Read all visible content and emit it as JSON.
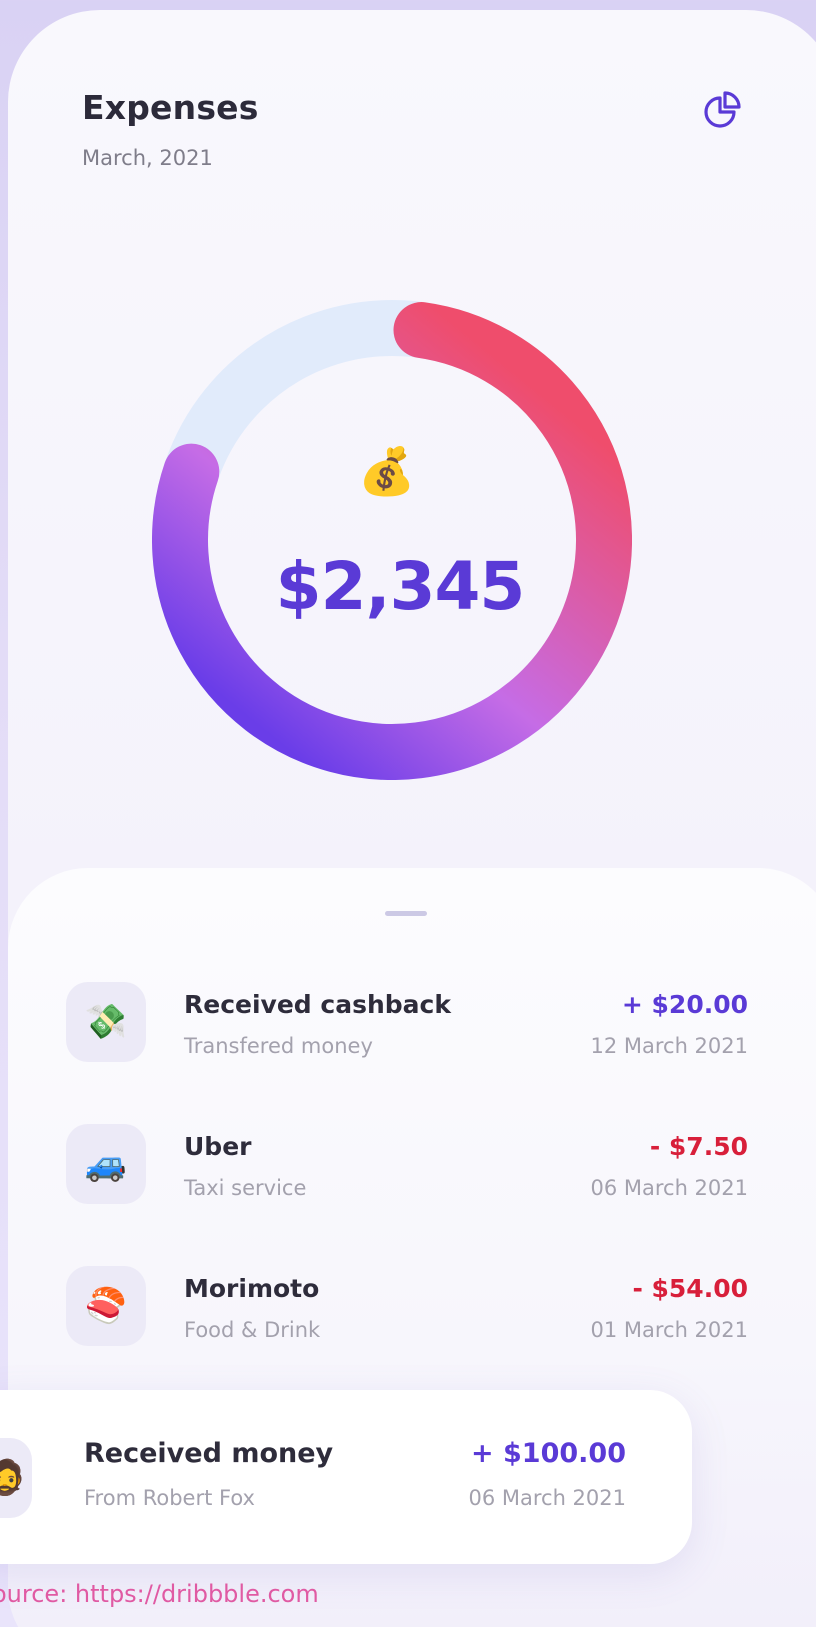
{
  "header": {
    "title": "Expenses",
    "subtitle": "March, 2021",
    "action_icon": "pie-chart-icon"
  },
  "summary": {
    "emoji": "💰",
    "total": "$2,345",
    "progress_fraction": 0.78,
    "colors": {
      "track": "#e1ebfb",
      "gradient_start": "#6a3de8",
      "gradient_mid": "#c56ce6",
      "gradient_end": "#ef4d6c",
      "accent": "#5a3ad6",
      "negative": "#d81f3a"
    }
  },
  "transactions": [
    {
      "emoji": "💸",
      "icon": "money-wings-icon",
      "title": "Received cashback",
      "subtitle": "Transfered money",
      "amount": "+ $20.00",
      "date": "12 March 2021",
      "type": "credit"
    },
    {
      "emoji": "🚙",
      "icon": "car-icon",
      "title": "Uber",
      "subtitle": "Taxi service",
      "amount": "- $7.50",
      "date": "06 March 2021",
      "type": "debit"
    },
    {
      "emoji": "🍣",
      "icon": "sushi-icon",
      "title": "Morimoto",
      "subtitle": "Food & Drink",
      "amount": "- $54.00",
      "date": "01 March 2021",
      "type": "debit"
    }
  ],
  "highlight": {
    "emoji": "🧔",
    "icon": "avatar-icon",
    "title": "Received money",
    "subtitle": "From Robert Fox",
    "amount": "+ $100.00",
    "date": "06 March 2021"
  },
  "footer": {
    "source": "ource: https://dribbble.com"
  }
}
